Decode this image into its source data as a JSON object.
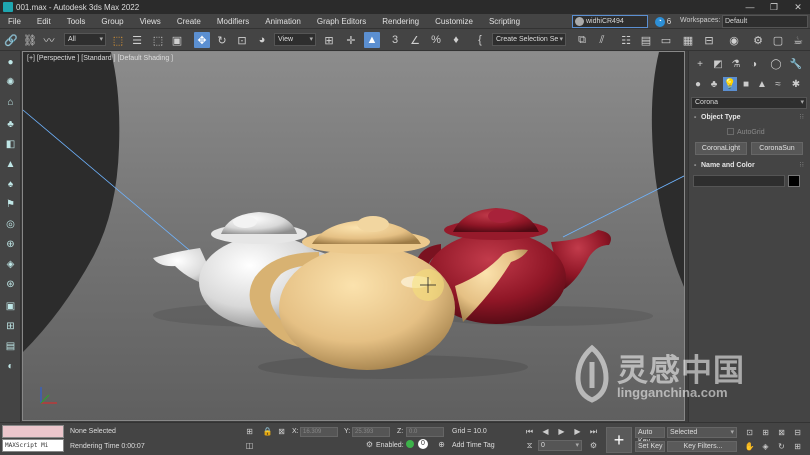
{
  "window": {
    "title": "001.max - Autodesk 3ds Max 2022",
    "controls": [
      "—",
      "❐",
      "✕"
    ]
  },
  "menu": {
    "items": [
      "File",
      "Edit",
      "Tools",
      "Group",
      "Views",
      "Create",
      "Modifiers",
      "Animation",
      "Graph Editors",
      "Rendering",
      "Customize",
      "Scripting"
    ],
    "user": "widhiCR494",
    "notifications": "6",
    "workspaces_label": "Workspaces:",
    "workspace_value": "Default"
  },
  "toolbar": {
    "selection_filter": "All",
    "reference_coord": "View",
    "named_selection": "Create Selection Se",
    "snap_label": "3",
    "angle_snap_label": "∠"
  },
  "viewport": {
    "label": "[+] [Perspective ] [Standard ] [Default Shading ]",
    "teapot_colors": [
      "#e9e9e9",
      "#e9c98a",
      "#9e1b2a"
    ]
  },
  "command_panel": {
    "category": "Corona",
    "object_type_title": "Object Type",
    "autogrid": "AutoGrid",
    "buttons": [
      "CoronaLight",
      "CoronaSun"
    ],
    "name_color_title": "Name and Color"
  },
  "status": {
    "selection": "None Selected",
    "render_time": "Rendering Time  0:00:07",
    "maxscript": "MAXScript Mi",
    "x_label": "X:",
    "x_value": "16.309",
    "y_label": "Y:",
    "y_value": "25.393",
    "z_label": "Z:",
    "z_value": "0.0",
    "grid": "Grid = 10.0",
    "enabled": "Enabled:",
    "enabled_count": "0",
    "add_time_tag": "Add Time Tag",
    "frame": "0",
    "auto_key": "Auto Key",
    "set_key": "Set Key",
    "key_mode": "Selected",
    "key_filters": "Key Filters..."
  },
  "watermark": {
    "title": "灵感中国",
    "url": "lingganchina.com"
  }
}
